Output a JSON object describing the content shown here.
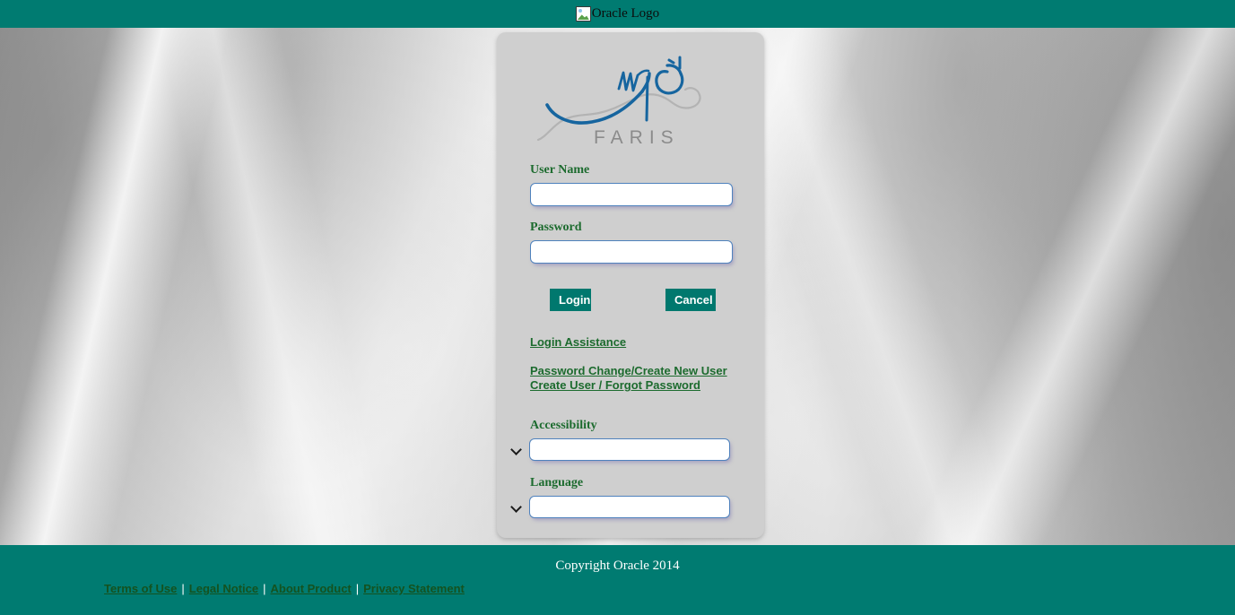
{
  "topbar": {
    "logo_alt": "Oracle Logo",
    "logo_icon": "broken-image-icon",
    "background_color": "#007b71"
  },
  "card": {
    "logo": {
      "wordmark": "FARIS",
      "script_color": "#16659f",
      "outline_color": "#b0b0b0",
      "wordmark_color": "#8b8b8b"
    },
    "fields": [
      {
        "label": "User Name",
        "value": "",
        "placeholder": "",
        "type": "text"
      },
      {
        "label": "Password",
        "value": "",
        "placeholder": "",
        "type": "password"
      }
    ],
    "buttons": {
      "login": "Login",
      "cancel": "Cancel"
    },
    "links": [
      "Login Assistance",
      "Password Change/Create New User",
      "Create User / Forgot Password"
    ],
    "selects": [
      {
        "label": "Accessibility",
        "value": "",
        "options": [
          ""
        ]
      },
      {
        "label": "Language",
        "value": "",
        "options": [
          ""
        ]
      }
    ],
    "background_color": "#cfcfcf",
    "label_color": "#1c6b2e",
    "link_color": "#1c6b2e",
    "input_border_color": "#4f82bd"
  },
  "footer": {
    "copyright": "Copyright Oracle 2014",
    "links": [
      "Terms of Use",
      "Legal Notice",
      "About Product",
      "Privacy Statement"
    ],
    "separator": "|",
    "background_color": "#007b71",
    "link_color": "#14521f"
  }
}
